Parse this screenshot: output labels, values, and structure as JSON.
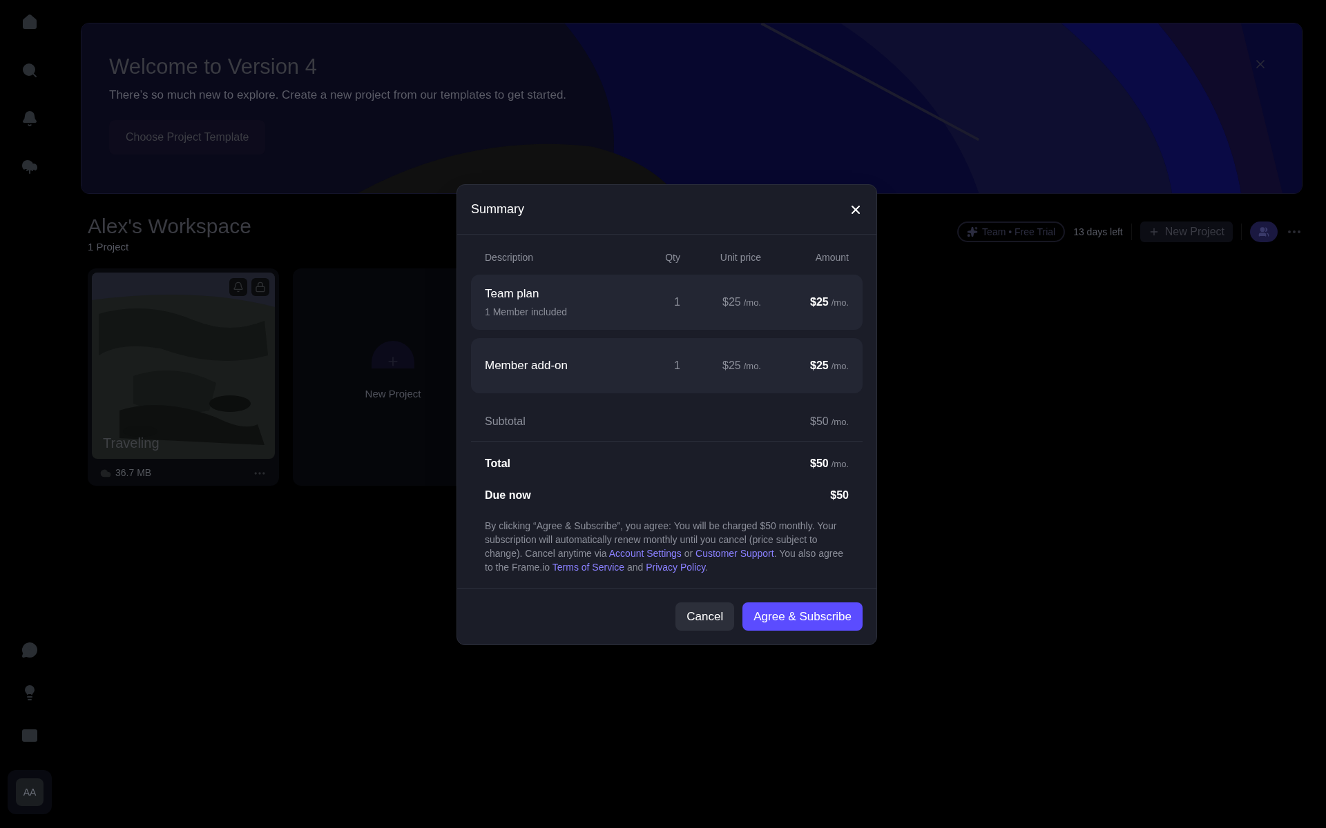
{
  "sidebar": {
    "avatar": "AA"
  },
  "banner": {
    "title": "Welcome to Version 4",
    "text": "There’s so much new to explore. Create a new project from our templates to get started.",
    "button": "Choose Project Template"
  },
  "workspace": {
    "title": "Alex's Workspace",
    "count": "1 Project",
    "plan": "Team • Free Trial",
    "days_left": "13 days left",
    "new_project": "New Project"
  },
  "projects": [
    {
      "name": "Traveling",
      "size": "36.7 MB"
    }
  ],
  "new_project_card": {
    "label": "New Project"
  },
  "dialog": {
    "title": "Summary",
    "columns": [
      "Description",
      "Qty",
      "Unit price",
      "Amount"
    ],
    "rows": [
      {
        "name": "Team plan",
        "note": "1 Member included",
        "qty": "1",
        "unit_price": "$25",
        "unit_period": "/mo.",
        "amount": "$25",
        "amount_period": "/mo."
      },
      {
        "name": "Member add-on",
        "qty": "1",
        "unit_price": "$25",
        "unit_period": "/mo.",
        "amount": "$25",
        "amount_period": "/mo."
      }
    ],
    "subtotal": {
      "label": "Subtotal",
      "amount": "$50",
      "period": "/mo."
    },
    "total": {
      "label": "Total",
      "amount": "$50",
      "period": "/mo."
    },
    "due_now": {
      "label": "Due now",
      "amount": "$50"
    },
    "disclaimer": [
      {
        "kind": "text",
        "text": "By clicking “Agree & Subscribe”, you agree: You will be charged $50 monthly. Your subscription will automatically renew monthly until you cancel (price subject to change). Cancel anytime via "
      },
      {
        "kind": "link",
        "text": "Account Settings"
      },
      {
        "kind": "text",
        "text": " or "
      },
      {
        "kind": "link",
        "text": "Customer Support"
      },
      {
        "kind": "text",
        "text": ". You also agree to the Frame.io "
      },
      {
        "kind": "link",
        "text": "Terms of Service"
      },
      {
        "kind": "text",
        "text": " and "
      },
      {
        "kind": "link",
        "text": "Privacy Policy"
      },
      {
        "kind": "text",
        "text": "."
      }
    ],
    "buttons": [
      {
        "label": "Cancel",
        "kind": "secondary"
      },
      {
        "label": "Agree & Subscribe",
        "kind": "primary"
      }
    ]
  }
}
